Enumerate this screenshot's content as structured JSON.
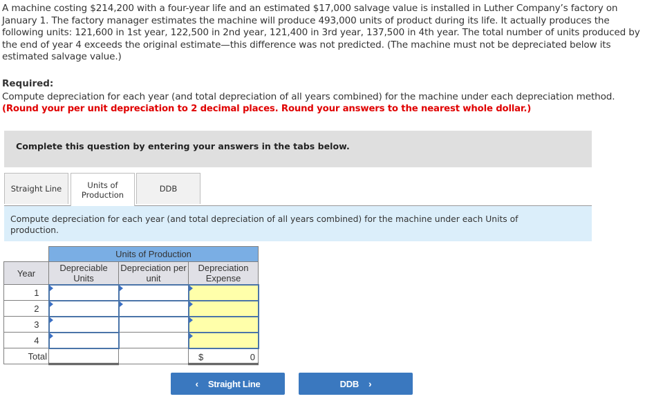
{
  "problem": {
    "intro": "A machine costing $214,200 with a four-year life and an estimated $17,000 salvage value is installed in Luther Company’s factory on January 1. The factory manager estimates the machine will produce 493,000 units of product during its life. It actually produces the following units: 121,600 in 1st year, 122,500 in 2nd year, 121,400 in 3rd year, 137,500 in 4th year. The total number of units produced by the end of year 4 exceeds the original estimate—this difference was not predicted. (The machine must not be depreciated below its estimated salvage value.)",
    "required_label": "Required:",
    "required_text": "Compute depreciation for each year (and total depreciation of all years combined) for the machine under each depreciation method.",
    "required_note": "(Round your per unit depreciation to 2 decimal places. Round your answers to the nearest whole dollar.)"
  },
  "instruction": "Complete this question by entering your answers in the tabs below.",
  "tabs": [
    {
      "label": "Straight Line",
      "active": false
    },
    {
      "label": "Units of Production",
      "active": true
    },
    {
      "label": "DDB",
      "active": false
    }
  ],
  "tab_description": "Compute depreciation for each year (and total depreciation of all years combined) for the machine under each Units of production.",
  "table": {
    "title": "Units of Production",
    "columns": [
      "Year",
      "Depreciable Units",
      "Depreciation per unit",
      "Depreciation Expense"
    ],
    "rows": [
      {
        "year": "1",
        "depreciable_units": "",
        "per_unit": "",
        "expense": ""
      },
      {
        "year": "2",
        "depreciable_units": "",
        "per_unit": "",
        "expense": ""
      },
      {
        "year": "3",
        "depreciable_units": "",
        "expense": ""
      },
      {
        "year": "4",
        "depreciable_units": "",
        "expense": ""
      }
    ],
    "total": {
      "label": "Total",
      "currency": "$",
      "expense": "0"
    }
  },
  "navigation": {
    "prev_label": "Straight Line",
    "next_label": "DDB",
    "prev_icon": "‹",
    "next_icon": "›"
  },
  "colors": {
    "accent": "#3a78bf",
    "table_header": "#7aaee4",
    "input_border": "#4a74a8",
    "computed_cell": "#ffffaa",
    "note_red": "#e00000",
    "desc_bg": "#dbeefa"
  }
}
